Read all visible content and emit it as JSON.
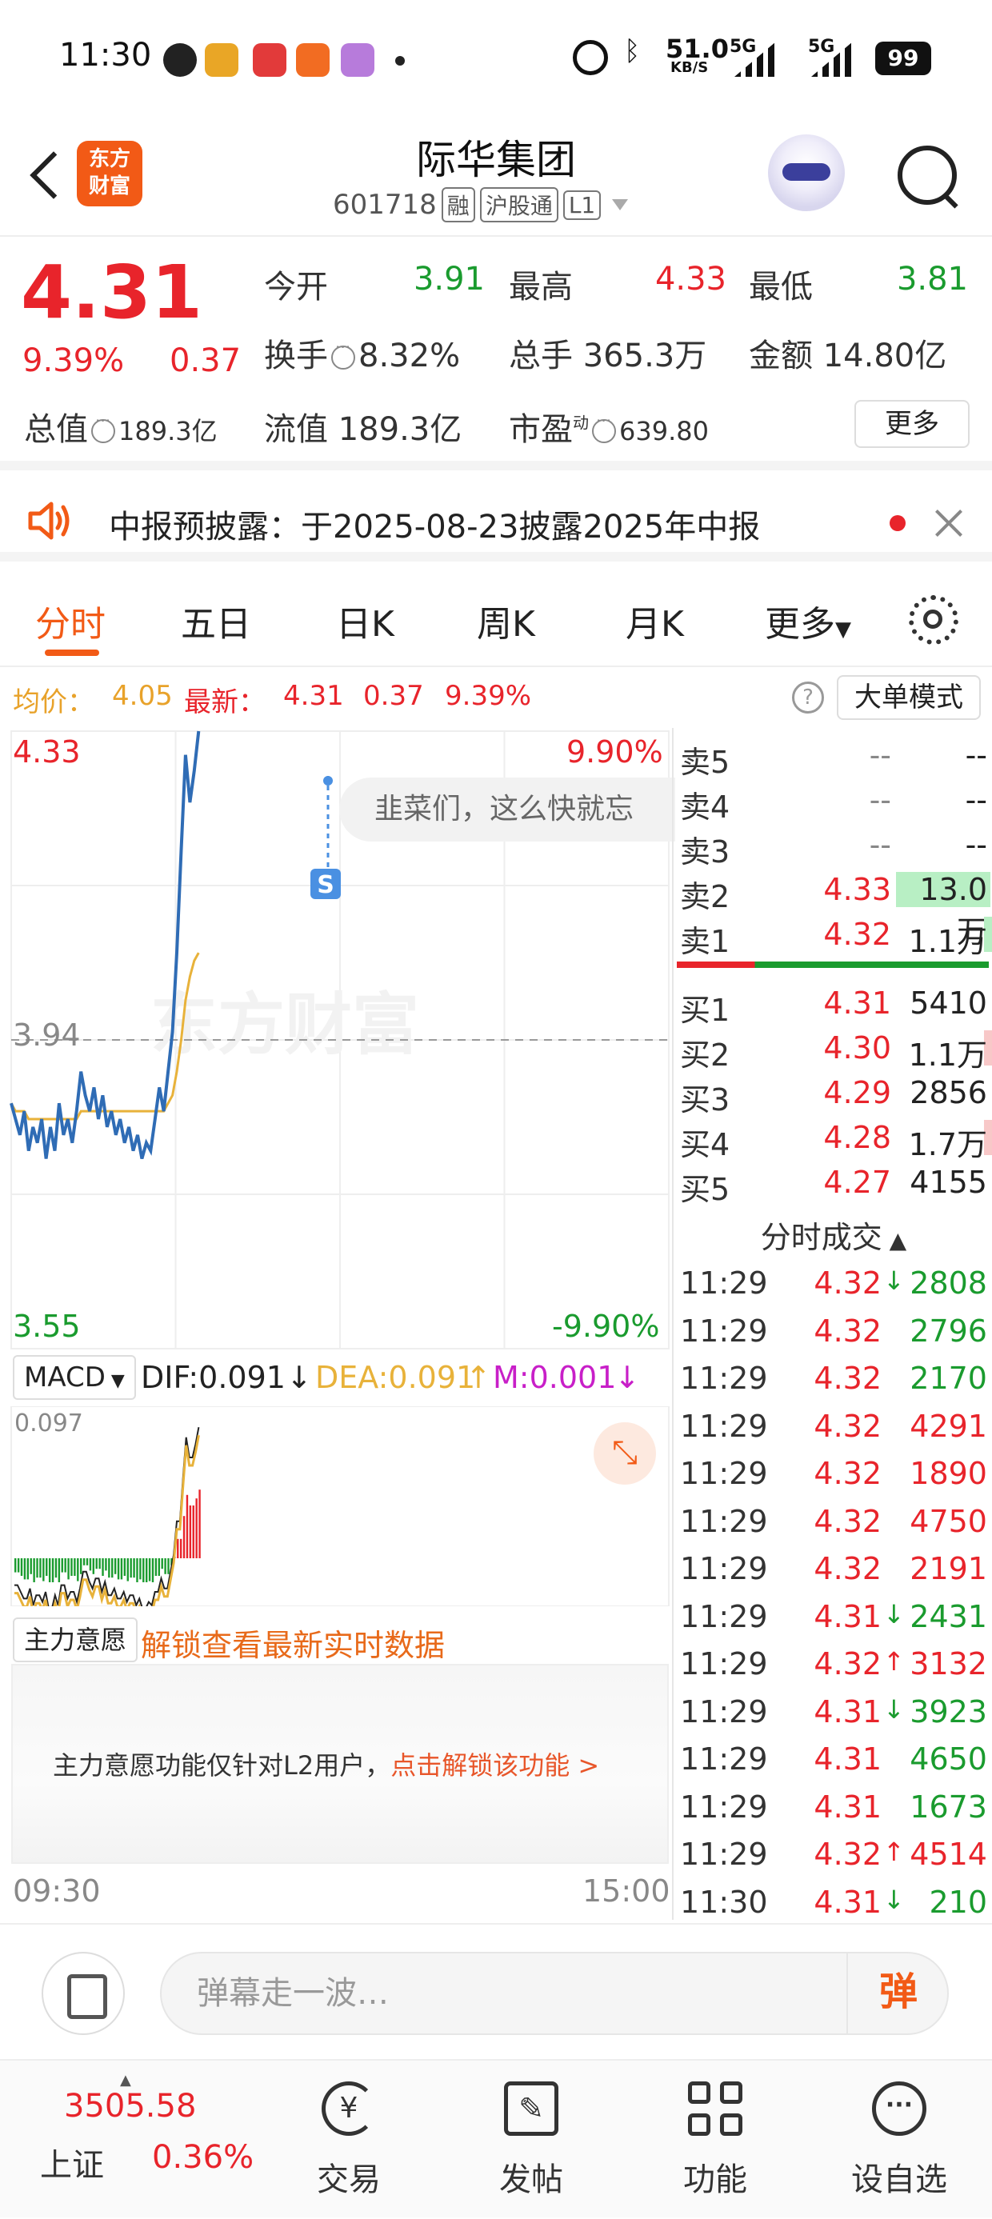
{
  "status": {
    "time": "11:30",
    "speed": "51.0",
    "speed_unit": "KB/S",
    "net1": "5G",
    "net2": "5G",
    "battery": "99"
  },
  "header": {
    "logo_line1": "东方",
    "logo_line2": "财富",
    "stock_name": "际华集团",
    "code": "601718",
    "tags": [
      "融",
      "沪股通",
      "L1"
    ]
  },
  "quote": {
    "price": "4.31",
    "change_pct": "9.39%",
    "change": "0.37",
    "stats": [
      {
        "label": "今开",
        "value": "3.91",
        "color": "green"
      },
      {
        "label": "最高",
        "value": "4.33",
        "color": "red"
      },
      {
        "label": "最低",
        "value": "3.81",
        "color": "green"
      }
    ],
    "turnover_label": "换手",
    "turnover": "8.32%",
    "volume_label": "总手",
    "volume": "365.3万",
    "amount_label": "金额",
    "amount": "14.80亿",
    "mktcap_label": "总值",
    "mktcap": "189.3亿",
    "float_label": "流值",
    "float": "189.3亿",
    "pe_label": "市盈",
    "pe_sup": "动",
    "pe": "639.80",
    "more_label": "更多"
  },
  "notice": {
    "text": "中报预披露：于2025-08-23披露2025年中报"
  },
  "tabs": [
    "分时",
    "五日",
    "日K",
    "周K",
    "月K",
    "更多"
  ],
  "infoline": {
    "avg_label": "均价：",
    "avg": "4.05",
    "last_label": "最新：",
    "last": "4.31",
    "change": "0.37",
    "change_pct": "9.39%",
    "help": "?",
    "big_order": "大单模式"
  },
  "chart": {
    "top_price": "4.33",
    "top_pct": "9.90%",
    "mid_price": "3.94",
    "bottom_price": "3.55",
    "bottom_pct": "-9.90%",
    "bubble": "韭菜们，这么快就忘",
    "watermark": "东方财富",
    "s_marker": "S",
    "macd_select": "MACD",
    "dif": "DIF:0.091",
    "dea": "DEA:0.091",
    "m": "M:0.001",
    "macd_max": "0.097",
    "zl_select": "主力意愿",
    "zl_unlock": "解锁查看最新实时数据",
    "zl_msg": "主力意愿功能仅针对L2用户，",
    "zl_link": "点击解锁该功能 >",
    "time_start": "09:30",
    "time_end": "15:00"
  },
  "chart_data": {
    "type": "line",
    "x_range": [
      "09:30",
      "15:00"
    ],
    "ylim": [
      3.55,
      4.33
    ],
    "pre_close": 3.94,
    "series": [
      {
        "name": "最新",
        "color": "#2f6cb5",
        "values": [
          3.86,
          3.84,
          3.82,
          3.85,
          3.8,
          3.83,
          3.81,
          3.84,
          3.79,
          3.83,
          3.8,
          3.86,
          3.82,
          3.84,
          3.81,
          3.85,
          3.9,
          3.87,
          3.85,
          3.88,
          3.84,
          3.87,
          3.83,
          3.85,
          3.82,
          3.84,
          3.81,
          3.83,
          3.8,
          3.82,
          3.79,
          3.81,
          3.8,
          3.84,
          3.88,
          3.85,
          3.9,
          3.95,
          4.05,
          4.18,
          4.3,
          4.24,
          4.28,
          4.33
        ]
      },
      {
        "name": "均价",
        "color": "#e8b23a",
        "values": [
          3.86,
          3.85,
          3.85,
          3.85,
          3.84,
          3.84,
          3.84,
          3.84,
          3.84,
          3.84,
          3.84,
          3.84,
          3.84,
          3.84,
          3.84,
          3.84,
          3.85,
          3.85,
          3.85,
          3.85,
          3.85,
          3.85,
          3.85,
          3.85,
          3.85,
          3.85,
          3.85,
          3.85,
          3.85,
          3.85,
          3.85,
          3.85,
          3.85,
          3.85,
          3.85,
          3.85,
          3.86,
          3.87,
          3.9,
          3.94,
          3.99,
          4.02,
          4.04,
          4.05
        ]
      }
    ]
  },
  "book": {
    "asks": [
      {
        "label": "卖5",
        "price": "--",
        "vol": "--"
      },
      {
        "label": "卖4",
        "price": "--",
        "vol": "--"
      },
      {
        "label": "卖3",
        "price": "--",
        "vol": "--"
      },
      {
        "label": "卖2",
        "price": "4.33",
        "vol": "13.0万"
      },
      {
        "label": "卖1",
        "price": "4.32",
        "vol": "1.1万"
      }
    ],
    "bids": [
      {
        "label": "买1",
        "price": "4.31",
        "vol": "5410"
      },
      {
        "label": "买2",
        "price": "4.30",
        "vol": "1.1万"
      },
      {
        "label": "买3",
        "price": "4.29",
        "vol": "2856"
      },
      {
        "label": "买4",
        "price": "4.28",
        "vol": "1.7万"
      },
      {
        "label": "买5",
        "price": "4.27",
        "vol": "4155"
      }
    ],
    "ticks_title": "分时成交",
    "ticks": [
      {
        "t": "11:29",
        "p": "4.32",
        "a": "↓",
        "v": "2808",
        "c": "green"
      },
      {
        "t": "11:29",
        "p": "4.32",
        "a": "",
        "v": "2796",
        "c": "green"
      },
      {
        "t": "11:29",
        "p": "4.32",
        "a": "",
        "v": "2170",
        "c": "green"
      },
      {
        "t": "11:29",
        "p": "4.32",
        "a": "",
        "v": "4291",
        "c": "red"
      },
      {
        "t": "11:29",
        "p": "4.32",
        "a": "",
        "v": "1890",
        "c": "red"
      },
      {
        "t": "11:29",
        "p": "4.32",
        "a": "",
        "v": "4750",
        "c": "red"
      },
      {
        "t": "11:29",
        "p": "4.32",
        "a": "",
        "v": "2191",
        "c": "red"
      },
      {
        "t": "11:29",
        "p": "4.31",
        "a": "↓",
        "v": "2431",
        "c": "green"
      },
      {
        "t": "11:29",
        "p": "4.32",
        "a": "↑",
        "v": "3132",
        "c": "red"
      },
      {
        "t": "11:29",
        "p": "4.31",
        "a": "↓",
        "v": "3923",
        "c": "green"
      },
      {
        "t": "11:29",
        "p": "4.31",
        "a": "",
        "v": "4650",
        "c": "green"
      },
      {
        "t": "11:29",
        "p": "4.31",
        "a": "",
        "v": "1673",
        "c": "green"
      },
      {
        "t": "11:29",
        "p": "4.32",
        "a": "↑",
        "v": "4514",
        "c": "red"
      },
      {
        "t": "11:30",
        "p": "4.31",
        "a": "↓",
        "v": "210",
        "c": "green"
      }
    ]
  },
  "comment": {
    "placeholder": "弹幕走一波…",
    "dan": "弹"
  },
  "nav": {
    "index_value": "3505.58",
    "index_name": "上证",
    "index_pct": "0.36%",
    "items": [
      "交易",
      "发帖",
      "功能",
      "设自选"
    ]
  }
}
